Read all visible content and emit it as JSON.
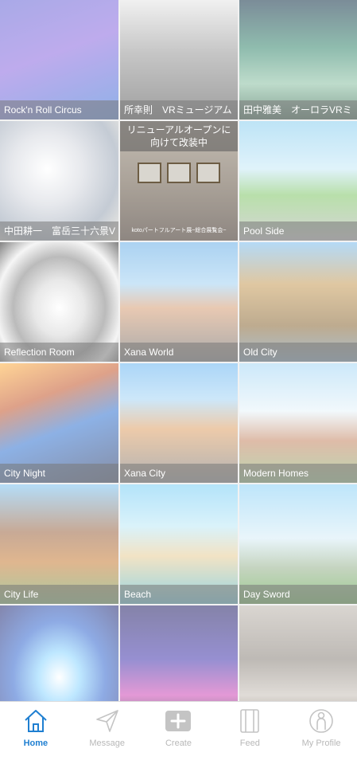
{
  "worlds": [
    {
      "title": "Rock'n Roll Circus",
      "bg": "linear-gradient(160deg,#6b6cd6 0%,#8f6fe0 45%,#3f78d6 100%)"
    },
    {
      "title": "所幸則　VRミュージアム",
      "bg": "linear-gradient(180deg,#e6e6e6 0%,#9c9c9c 45%,#5a5a5a 100%)"
    },
    {
      "title": "田中雅美　オーロラVRミ",
      "bg": "linear-gradient(180deg,#1c3a4f 0%,#3f8c74 40%,#8fc2a6 70%,#2e5e46 100%)"
    },
    {
      "title": "中田耕一　富岳三十六景V",
      "bg": "radial-gradient(circle at 40% 40%,#ffffff 0%,#d6d9e0 35%,#9aa6b6 70%,#e9e3d4 100%)"
    },
    {
      "title": "kotoパートフルアート展~総合展覧会~",
      "banner": "リニューアルオープンに向けて改装中",
      "bg": "linear-gradient(180deg,#9a8d7d 0%,#6b5d4d 55%,#3d3027 100%)"
    },
    {
      "title": "Pool Side",
      "bg": "linear-gradient(180deg,#8fd0f0 0%,#c9eaf7 40%,#86c96e 62%,#b8b8b8 100%)"
    },
    {
      "title": "Reflection Room",
      "bg": "radial-gradient(ellipse at 50% 55%,#ffffff 0%,#d8d8d8 30%,#8a8a8a 55%,#efefef 75%,#2a2a2a 100%)"
    },
    {
      "title": "Xana World",
      "bg": "linear-gradient(180deg,#6fb2e8 0%,#a6d3f2 35%,#d8a27b 55%,#6d6d6d 100%)"
    },
    {
      "title": "Old City",
      "bg": "linear-gradient(180deg,#7fbff0 0%,#c9a05f 35%,#8f6f3f 70%,#6d8fa8 100%)"
    },
    {
      "title": "City Night",
      "bg": "linear-gradient(160deg,#ffb54a 0%,#c65e35 30%,#3b79d2 55%,#2e3c66 100%)"
    },
    {
      "title": "Xana City",
      "bg": "linear-gradient(180deg,#6fb8f2 0%,#a9d6f5 30%,#e0a56d 55%,#7a7a7a 100%)"
    },
    {
      "title": "Modern Homes",
      "bg": "linear-gradient(180deg,#a8d8f5 0%,#e8f4fa 40%,#c78b6a 65%,#8bb978 100%)"
    },
    {
      "title": "City Life",
      "bg": "linear-gradient(180deg,#7fc4f2 0%,#a06c4a 40%,#c9823f 65%,#6fa35a 100%)"
    },
    {
      "title": "Beach",
      "bg": "linear-gradient(180deg,#7ed0f5 0%,#bfe9f7 35%,#e8cf9b 60%,#4fb6c9 100%)"
    },
    {
      "title": "Day Sword",
      "bg": "linear-gradient(180deg,#8fd3f7 0%,#d9eef7 45%,#9bb592 70%,#56a540 100%)"
    },
    {
      "title": "",
      "bg": "radial-gradient(ellipse at 50% 60%,#ffffff 0%,#8fd6ff 25%,#3d6ed1 55%,#2a2f73 100%)"
    },
    {
      "title": "",
      "bg": "linear-gradient(180deg,#2d2a6b 0%,#4b3fb0 45%,#d050b8 75%,#1e1e3c 100%)"
    },
    {
      "title": "",
      "bg": "linear-gradient(180deg,#bfb8b0 0%,#8f8880 45%,#c9c2ba 75%,#6b5c50 100%)"
    }
  ],
  "tabbar": {
    "home": "Home",
    "message": "Message",
    "create": "Create",
    "feed": "Feed",
    "profile": "My Profile"
  },
  "colors": {
    "active": "#1f7fd1",
    "inactive": "#b8b8b8"
  }
}
